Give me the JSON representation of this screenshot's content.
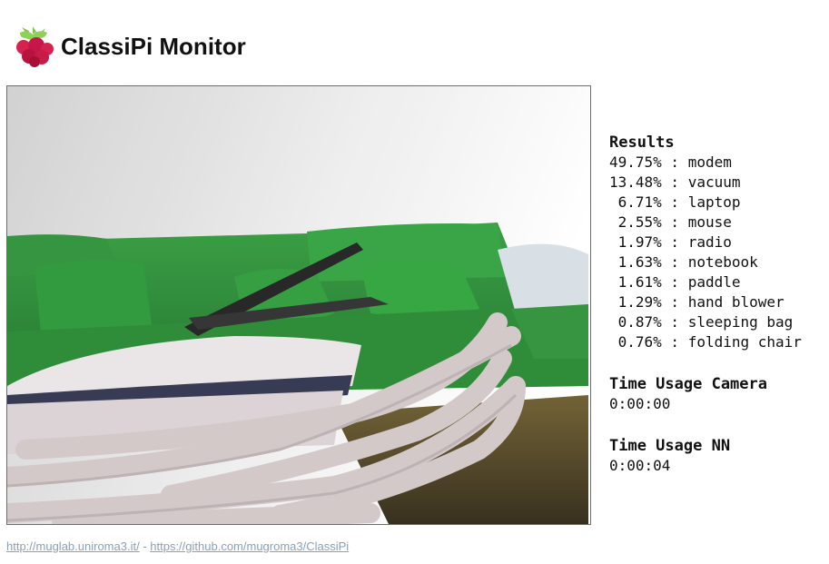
{
  "header": {
    "title": "ClassiPi Monitor",
    "logo_icon": "raspberry-pi-logo-icon"
  },
  "camera": {
    "icon": "camera-feed-image"
  },
  "results": {
    "title": "Results",
    "rows": [
      "49.75% : modem",
      "13.48% : vacuum",
      " 6.71% : laptop",
      " 2.55% : mouse",
      " 1.97% : radio",
      " 1.63% : notebook",
      " 1.61% : paddle",
      " 1.29% : hand blower",
      " 0.87% : sleeping bag",
      " 0.76% : folding chair"
    ]
  },
  "time_camera": {
    "title": "Time Usage Camera",
    "value": "0:00:00"
  },
  "time_nn": {
    "title": "Time Usage NN",
    "value": "0:00:04"
  },
  "footer": {
    "link1": "http://muglab.uniroma3.it/",
    "separator": " - ",
    "link2": "https://github.com/mugroma3/ClassiPi"
  }
}
